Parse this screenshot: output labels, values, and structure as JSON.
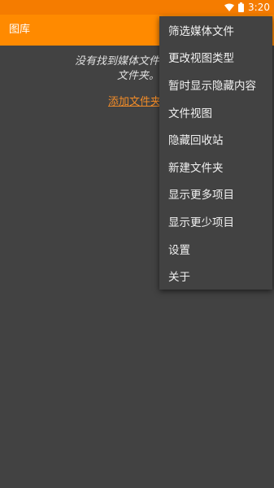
{
  "status_bar": {
    "time": "3:20",
    "icons": [
      "wifi-icon",
      "battery-icon"
    ],
    "color": "#f57c00"
  },
  "app_bar": {
    "title": "图库",
    "color": "#ff8a00"
  },
  "empty_state": {
    "message_line1": "没有找到媒体文件。请手动",
    "message_line2": "文件夹。",
    "add_folder_link": "添加文件夹"
  },
  "overflow_menu": {
    "items": [
      {
        "label": "筛选媒体文件"
      },
      {
        "label": "更改视图类型"
      },
      {
        "label": "暂时显示隐藏内容"
      },
      {
        "label": "文件视图"
      },
      {
        "label": "隐藏回收站"
      },
      {
        "label": "新建文件夹"
      },
      {
        "label": "显示更多项目"
      },
      {
        "label": "显示更少项目"
      },
      {
        "label": "设置"
      },
      {
        "label": "关于"
      }
    ]
  },
  "colors": {
    "background": "#424242",
    "accent": "#ff8a00",
    "link": "#f28c28"
  }
}
